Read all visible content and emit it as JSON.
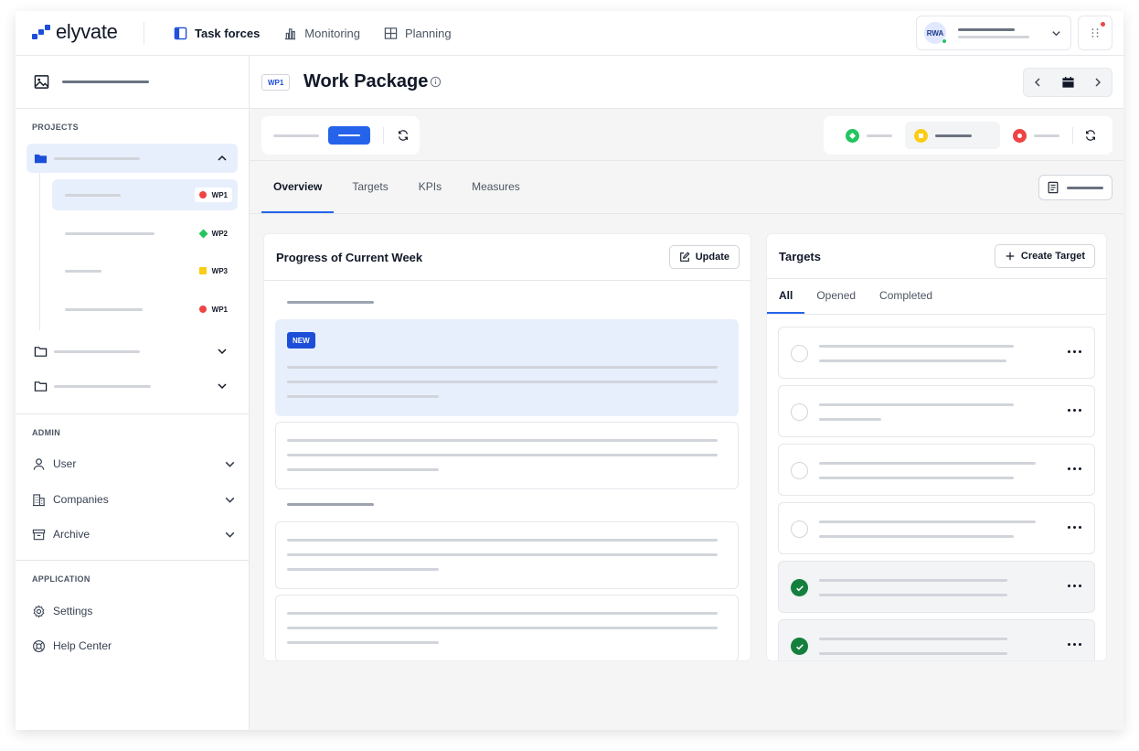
{
  "app": {
    "brand": "elyvate"
  },
  "topnav": [
    {
      "label": "Task forces",
      "icon": "task-forces-icon",
      "active": true
    },
    {
      "label": "Monitoring",
      "icon": "chart-icon",
      "active": false
    },
    {
      "label": "Planning",
      "icon": "grid-icon",
      "active": false
    }
  ],
  "user": {
    "initials": "RWA"
  },
  "sidebar": {
    "projects_label": "PROJECTS",
    "work_packages": [
      {
        "code": "WP1",
        "status": "red",
        "active": true
      },
      {
        "code": "WP2",
        "status": "green",
        "active": false
      },
      {
        "code": "WP3",
        "status": "yellow",
        "active": false
      },
      {
        "code": "WP1",
        "status": "red",
        "active": false
      }
    ],
    "admin_label": "ADMIN",
    "admin_items": [
      {
        "label": "User",
        "icon": "user-icon"
      },
      {
        "label": "Companies",
        "icon": "building-icon"
      },
      {
        "label": "Archive",
        "icon": "archive-icon"
      }
    ],
    "application_label": "APPLICATION",
    "app_items": [
      {
        "label": "Settings",
        "icon": "gear-icon"
      },
      {
        "label": "Help Center",
        "icon": "lifebuoy-icon"
      }
    ]
  },
  "page": {
    "tag": "WP1",
    "title": "Work Package"
  },
  "tabs": [
    "Overview",
    "Targets",
    "KPIs",
    "Measures"
  ],
  "progress_card": {
    "title": "Progress of Current Week",
    "update_label": "Update",
    "new_badge": "NEW"
  },
  "targets_card": {
    "title": "Targets",
    "create_label": "Create Target",
    "tabs": [
      "All",
      "Opened",
      "Completed"
    ],
    "rows": [
      {
        "done": false
      },
      {
        "done": false
      },
      {
        "done": false
      },
      {
        "done": false
      },
      {
        "done": true
      },
      {
        "done": true
      }
    ]
  },
  "colors": {
    "accent": "#2563eb",
    "status_red": "#ef4444",
    "status_green": "#22c55e",
    "status_yellow": "#facc15",
    "done_green": "#15803d"
  }
}
